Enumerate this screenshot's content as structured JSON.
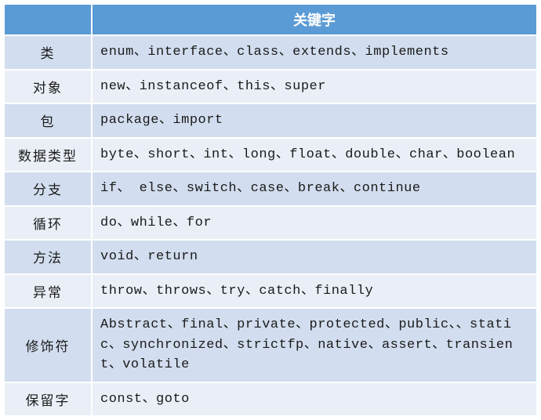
{
  "header": {
    "title": "关键字"
  },
  "rows": [
    {
      "category": "类",
      "keywords": "enum、interface、class、extends、implements"
    },
    {
      "category": "对象",
      "keywords": "new、instanceof、this、super"
    },
    {
      "category": "包",
      "keywords": "package、import"
    },
    {
      "category": "数据类型",
      "keywords": "byte、short、int、long、float、double、char、boolean"
    },
    {
      "category": "分支",
      "keywords": "if、 else、switch、case、break、continue"
    },
    {
      "category": "循环",
      "keywords": "do、while、for"
    },
    {
      "category": "方法",
      "keywords": "void、return"
    },
    {
      "category": "异常",
      "keywords": "throw、throws、try、catch、finally"
    },
    {
      "category": "修饰符",
      "keywords": "Abstract、final、private、protected、public、、static、synchronized、strictfp、native、assert、transient、volatile"
    },
    {
      "category": "保留字",
      "keywords": "const、goto"
    }
  ]
}
